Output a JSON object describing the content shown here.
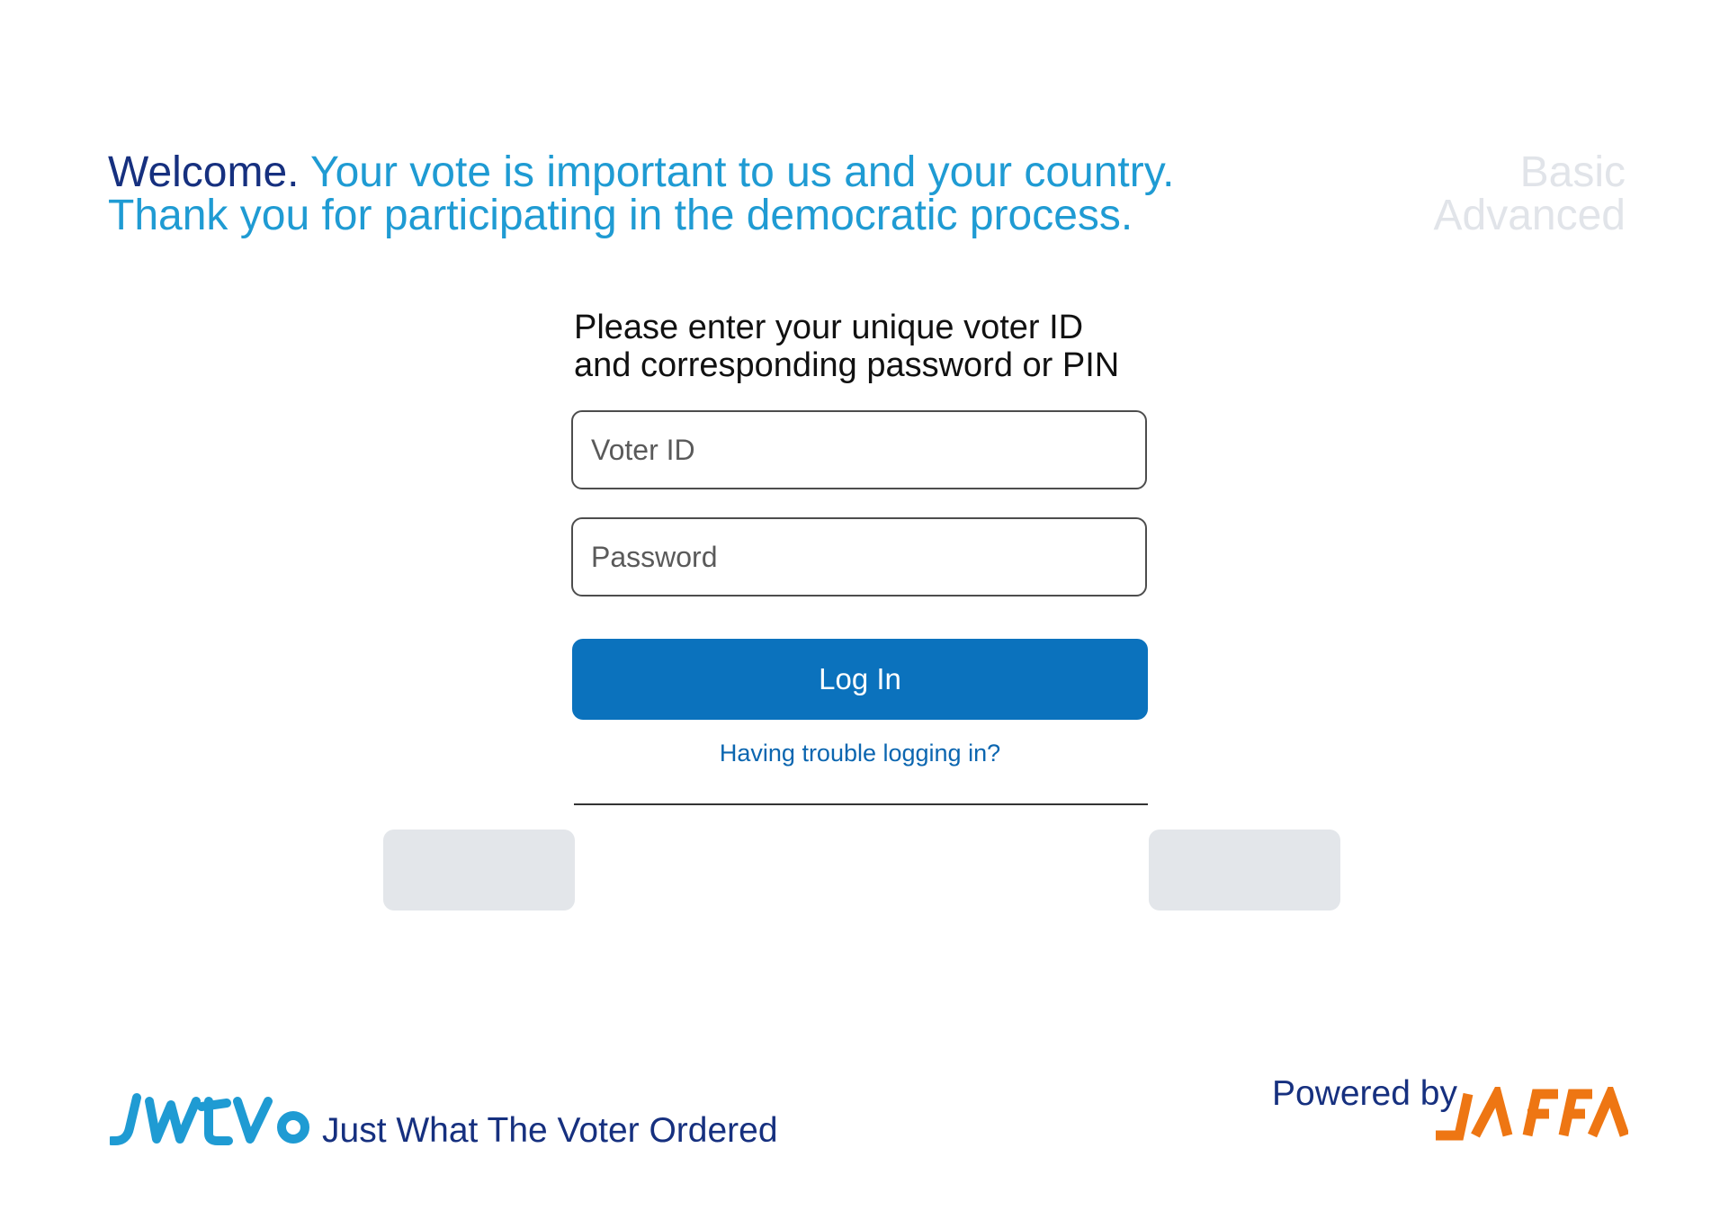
{
  "header": {
    "welcome_strong": "Welcome.",
    "welcome_line1": "Your vote is important to us and your country.",
    "welcome_line2": "Thank you for participating in the democratic process."
  },
  "mode_switch": {
    "basic": "Basic",
    "advanced": "Advanced"
  },
  "login": {
    "prompt_line1": "Please enter your unique voter ID",
    "prompt_line2": "and corresponding password or PIN",
    "voter_id_placeholder": "Voter ID",
    "password_placeholder": "Password",
    "login_label": "Log In",
    "trouble_link": "Having trouble logging in?"
  },
  "footer": {
    "logo_text": "JWTVO",
    "tagline": "Just What The Voter Ordered",
    "powered_by": "Powered by",
    "partner_logo_text": "JAFFA"
  },
  "colors": {
    "brand_dark_blue": "#16307f",
    "brand_light_blue": "#1f9bd3",
    "button_blue": "#0b72bd",
    "partner_orange": "#ee7613"
  }
}
